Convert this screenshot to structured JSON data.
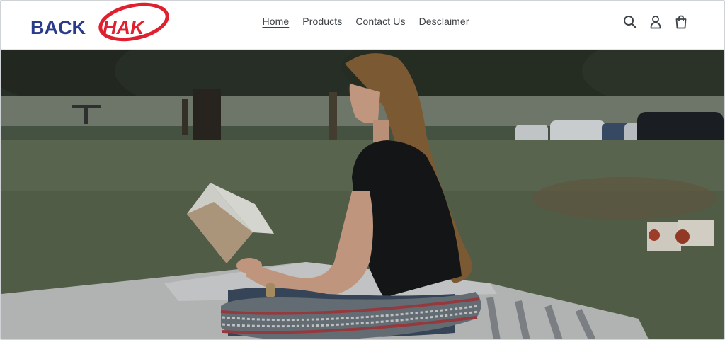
{
  "brand": {
    "logo_text_dark": "BACK",
    "logo_text_red": "HAK",
    "colors": {
      "dark": "#2a3a8c",
      "red": "#e0202f"
    }
  },
  "nav": {
    "items": [
      {
        "label": "Home",
        "active": true
      },
      {
        "label": "Products",
        "active": false
      },
      {
        "label": "Contact Us",
        "active": false
      },
      {
        "label": "Desclaimer",
        "active": false
      }
    ]
  },
  "header_icons": [
    "search-icon",
    "account-icon",
    "cart-icon"
  ],
  "hero": {
    "image": "woman-reading-on-blanket-in-park"
  }
}
